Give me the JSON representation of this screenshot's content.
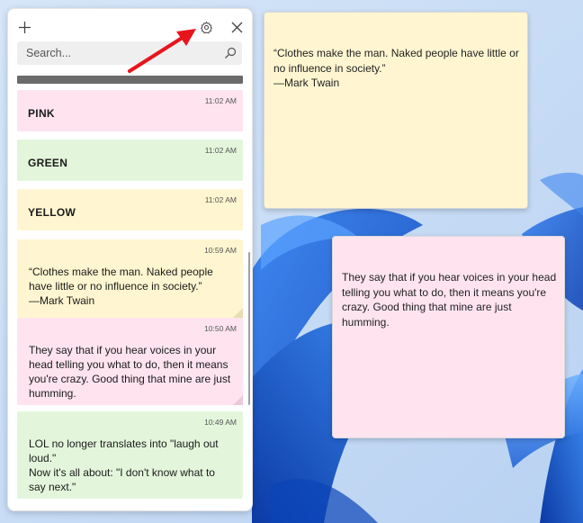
{
  "panel": {
    "search_placeholder": "Search...",
    "icons": {
      "add": "plus-icon",
      "settings": "gear-icon",
      "close": "close-icon",
      "search": "search-icon"
    },
    "notes": [
      {
        "id": "pink",
        "color": "pink",
        "time": "11:02 AM",
        "title": "PINK"
      },
      {
        "id": "green",
        "color": "green",
        "time": "11:02 AM",
        "title": "GREEN"
      },
      {
        "id": "yellow",
        "color": "yellow",
        "time": "11:02 AM",
        "title": "YELLOW"
      },
      {
        "id": "quote",
        "color": "yellow",
        "time": "10:59 AM",
        "lines": [
          "“Clothes make the man. Naked people",
          "have little or no influence in society.”",
          "—Mark Twain"
        ]
      },
      {
        "id": "voices",
        "color": "pink",
        "time": "10:50 AM",
        "lines": [
          "They say that if you hear voices in your",
          "head telling you what to do, then it means",
          "you're crazy. Good thing that mine are just",
          "humming."
        ]
      },
      {
        "id": "lol",
        "color": "green",
        "time": "10:49 AM",
        "lines": [
          "LOL no longer translates into \"laugh out",
          "loud.\"",
          "Now it's all about: \"I don't know what to",
          "say next.\""
        ]
      }
    ]
  },
  "sticky_notes": [
    {
      "id": "open-yellow",
      "color": "#fff6d1",
      "lines": [
        "“Clothes make the man. Naked people have little or",
        "no influence in society.”",
        "—Mark Twain"
      ]
    },
    {
      "id": "open-pink",
      "color": "#ffe4f0",
      "lines": [
        "They say that if you hear voices in your head",
        "telling you what to do, then it means you're",
        "crazy. Good thing that mine are just",
        "humming."
      ]
    }
  ],
  "colors": {
    "pink": "#ffe4f0",
    "green": "#e3f6dc",
    "yellow": "#fff6d1",
    "annotation_arrow": "#e8141c"
  }
}
